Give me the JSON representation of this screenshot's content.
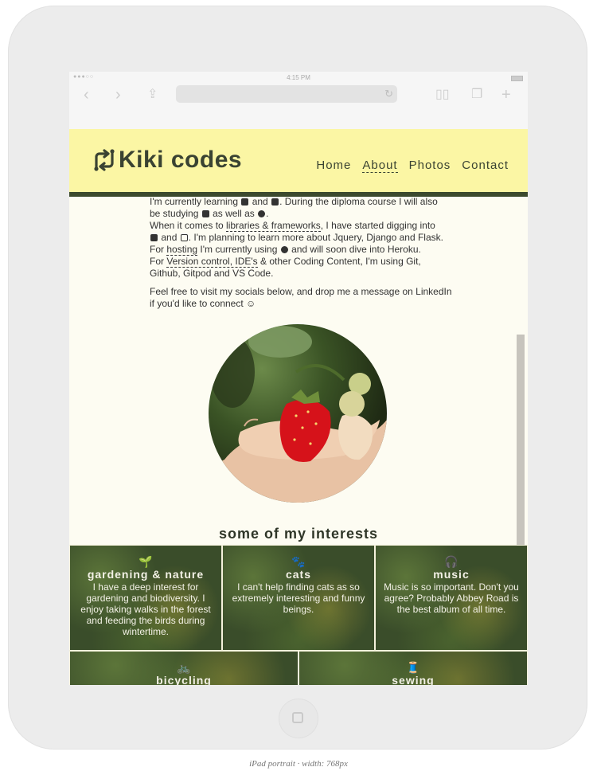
{
  "device": {
    "caption": "iPad portrait · width: 768px"
  },
  "status_bar": {
    "time": "4:15 PM",
    "signal": "●●●○○"
  },
  "site": {
    "logo_icon": "sync-arrows-icon",
    "title": "Kiki codes",
    "nav": [
      {
        "label": "Home",
        "active": false
      },
      {
        "label": "About",
        "active": true
      },
      {
        "label": "Photos",
        "active": false
      },
      {
        "label": "Contact",
        "active": false
      }
    ]
  },
  "about": {
    "line1": "I'm currently learning",
    "line1_b": "and",
    "line1_c": ". During the diploma course I will also",
    "line2_a": "be studying",
    "line2_b": "as well as",
    "line3_a": "When it comes to",
    "line3_link": "libraries & frameworks",
    "line3_b": ", I have started digging into",
    "line4_a": "and",
    "line4_b": ". I'm planning to learn more about Jquery, Django and Flask.",
    "line5_a": "For",
    "line5_link": "hosting",
    "line5_b": "I'm currently using",
    "line5_c": "and will soon dive into Heroku.",
    "line6_a": "For",
    "line6_link": "Version control, IDE's",
    "line6_b": "& other Coding Content, I'm using Git,",
    "line7": "Github, Gitpod and VS Code.",
    "para2": "Feel free to visit my socials below, and drop me a message on LinkedIn if you'd like to connect",
    "smiley": "☺"
  },
  "interests": {
    "heading": "some of my interests",
    "cards": [
      {
        "icon": "sprout-icon",
        "glyph": "🌱",
        "title": "gardening & nature",
        "desc": "I have a deep interest for gardening and biodiversity. I enjoy taking walks in the forest and feeding the birds during wintertime."
      },
      {
        "icon": "paw-icon",
        "glyph": "🐾",
        "title": "cats",
        "desc": "I can't help finding cats as so extremely interesting and funny beings."
      },
      {
        "icon": "headphones-icon",
        "glyph": "🎧",
        "title": "music",
        "desc": "Music is so important. Don't you agree? Probably Abbey Road is the best album of all time."
      },
      {
        "icon": "bicycle-icon",
        "glyph": "🚲",
        "title": "bicycling",
        "desc": ""
      },
      {
        "icon": "sewing-icon",
        "glyph": "🧵",
        "title": "sewing",
        "desc": ""
      }
    ]
  },
  "colors": {
    "header_bg": "#fbf6a4",
    "header_border": "#3c4a2e",
    "text_dark": "#3a4332",
    "page_bg": "#fdfcf2"
  }
}
